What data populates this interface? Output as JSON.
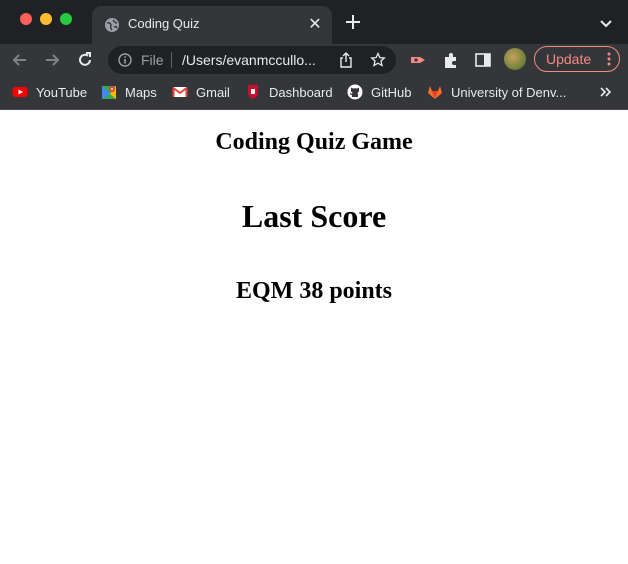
{
  "browser": {
    "tab": {
      "title": "Coding Quiz",
      "close_glyph": "✕",
      "icon": "globe-icon"
    },
    "address_bar": {
      "scheme_label": "File",
      "url": "/Users/evanmccullo..."
    },
    "update_button": {
      "label": "Update",
      "color": "#f28b82"
    },
    "bookmarks": [
      {
        "label": "YouTube",
        "icon": "youtube-icon"
      },
      {
        "label": "Maps",
        "icon": "maps-icon"
      },
      {
        "label": "Gmail",
        "icon": "gmail-icon"
      },
      {
        "label": "Dashboard",
        "icon": "dashboard-icon"
      },
      {
        "label": "GitHub",
        "icon": "github-icon"
      },
      {
        "label": "University of Denv...",
        "icon": "gitlab-icon"
      }
    ]
  },
  "page": {
    "app_title": "Coding Quiz Game",
    "section_heading": "Last Score",
    "score_text": "EQM 38 points"
  }
}
